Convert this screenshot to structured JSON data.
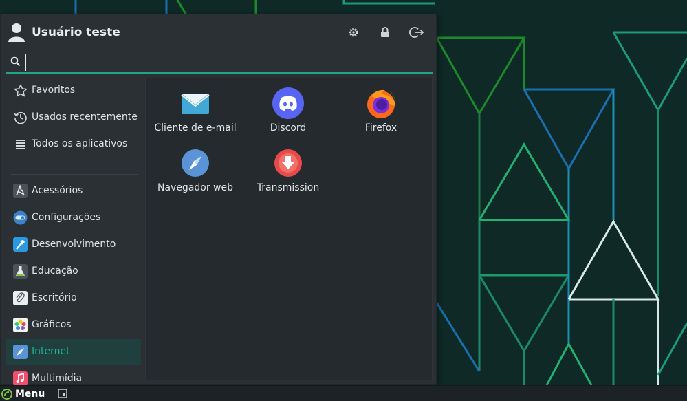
{
  "colors": {
    "accent": "#1fa58a",
    "menu_bg": "#2b3035",
    "panel_bg": "#252a2e",
    "active_bg": "#203f3f",
    "wallpaper_bg": "#0f2a26"
  },
  "header": {
    "user_name": "Usuário teste",
    "icons": [
      "settings-icon",
      "lock-icon",
      "logout-icon"
    ]
  },
  "search": {
    "value": "",
    "placeholder": ""
  },
  "sidebar": {
    "items": [
      {
        "label": "Favoritos",
        "icon": "star-icon"
      },
      {
        "label": "Usados recentemente",
        "icon": "history-icon"
      },
      {
        "label": "Todos os aplicativos",
        "icon": "list-icon"
      },
      {
        "label": "Acessórios",
        "icon": "accessories-icon"
      },
      {
        "label": "Configurações",
        "icon": "settings-toggle-icon"
      },
      {
        "label": "Desenvolvimento",
        "icon": "hammer-icon"
      },
      {
        "label": "Educação",
        "icon": "flask-icon"
      },
      {
        "label": "Escritório",
        "icon": "paperclip-icon"
      },
      {
        "label": "Gráficos",
        "icon": "graphics-icon"
      },
      {
        "label": "Internet",
        "icon": "compass-icon",
        "active": true
      },
      {
        "label": "Multimídia",
        "icon": "music-icon"
      }
    ]
  },
  "apps": [
    {
      "label": "Cliente de e-mail",
      "icon": "mail-icon"
    },
    {
      "label": "Discord",
      "icon": "discord-icon"
    },
    {
      "label": "Firefox",
      "icon": "firefox-icon"
    },
    {
      "label": "Navegador web",
      "icon": "browser-compass-icon"
    },
    {
      "label": "Transmission",
      "icon": "transmission-icon"
    }
  ],
  "taskbar": {
    "menu_label": "Menu"
  }
}
